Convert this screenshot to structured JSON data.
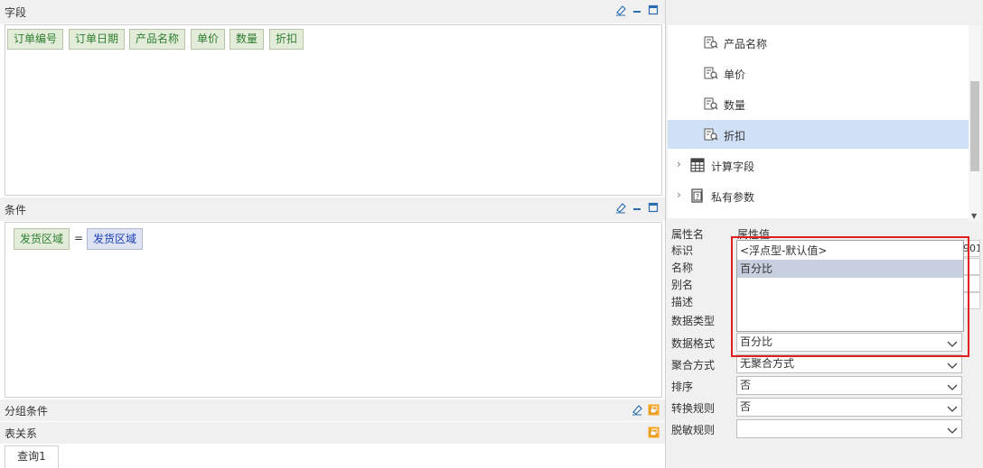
{
  "fields_section": {
    "title": "字段",
    "chips": [
      "订单编号",
      "订单日期",
      "产品名称",
      "单价",
      "数量",
      "折扣"
    ]
  },
  "condition_section": {
    "title": "条件",
    "left_field": "发货区域",
    "operator": "=",
    "right_value": "发货区域"
  },
  "group_section": {
    "title": "分组条件"
  },
  "relation_section": {
    "title": "表关系"
  },
  "bottom_tab": {
    "label": "查询1"
  },
  "tree": {
    "items": [
      {
        "label": "产品名称",
        "icon": "field-icon",
        "selected": false
      },
      {
        "label": "单价",
        "icon": "field-icon",
        "selected": false
      },
      {
        "label": "数量",
        "icon": "field-icon",
        "selected": false
      },
      {
        "label": "折扣",
        "icon": "field-icon",
        "selected": true
      },
      {
        "label": "计算字段",
        "icon": "calculator-icon",
        "expandable": true
      },
      {
        "label": "私有参数",
        "icon": "parameter-icon",
        "expandable": true
      }
    ]
  },
  "properties": {
    "header_name": "属性名",
    "header_value": "属性值",
    "rows": [
      {
        "name": "标识"
      },
      {
        "name": "名称"
      },
      {
        "name": "别名"
      },
      {
        "name": "描述"
      },
      {
        "name": "数据类型"
      },
      {
        "name": "数据格式",
        "value": "百分比"
      },
      {
        "name": "聚合方式",
        "value": "无聚合方式"
      },
      {
        "name": "排序",
        "value": "否"
      },
      {
        "name": "转换规则",
        "value": "否"
      },
      {
        "name": "脱敏规则",
        "value": ""
      }
    ],
    "id_value_fragment": "901"
  },
  "format_dropdown": {
    "options": [
      "<浮点型-默认值>",
      "百分比"
    ],
    "highlighted": "百分比"
  },
  "colors": {
    "chip_text": "#2e7d32",
    "value_chip_text": "#1a3db8",
    "selected_row": "#cfe0f7",
    "highlight_box": "#e02020"
  }
}
